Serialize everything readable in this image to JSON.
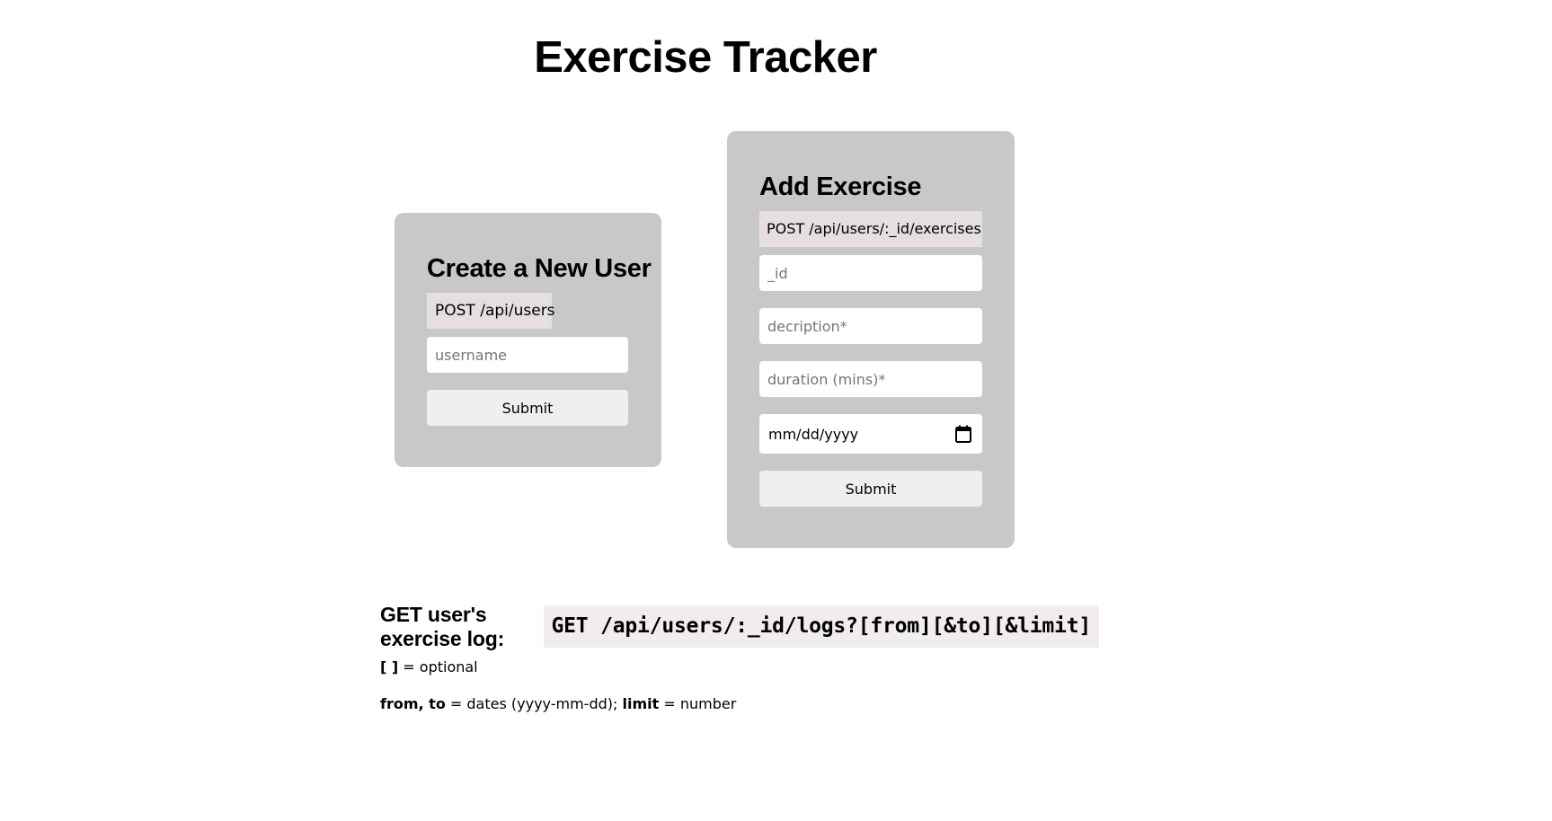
{
  "header": {
    "title": "Exercise Tracker"
  },
  "create_user": {
    "title": "Create a New User",
    "endpoint": "POST /api/users",
    "username_placeholder": "username",
    "submit_label": "Submit"
  },
  "add_exercise": {
    "title": "Add Exercise",
    "endpoint": "POST /api/users/:_id/exercises",
    "id_placeholder": "_id",
    "description_placeholder": "decription*",
    "duration_placeholder": "duration (mins)*",
    "date_value": "mm/dd/yyyy",
    "date_icon": "calendar-icon",
    "submit_label": "Submit"
  },
  "log": {
    "label": "GET user's exercise log:",
    "endpoint": "GET /api/users/:_id/logs?[from][&to][&limit]",
    "optional_brackets": "[ ]",
    "optional_text": " = optional",
    "params_from_to": "from, to",
    "params_dates_text": " = dates (yyyy-mm-dd); ",
    "params_limit": "limit",
    "params_limit_text": " = number"
  },
  "colors": {
    "card_bg": "#c8c8c8",
    "endpoint_bg": "#e5dfdf",
    "log_endpoint_bg": "#f1eded",
    "button_bg": "#efefef"
  }
}
